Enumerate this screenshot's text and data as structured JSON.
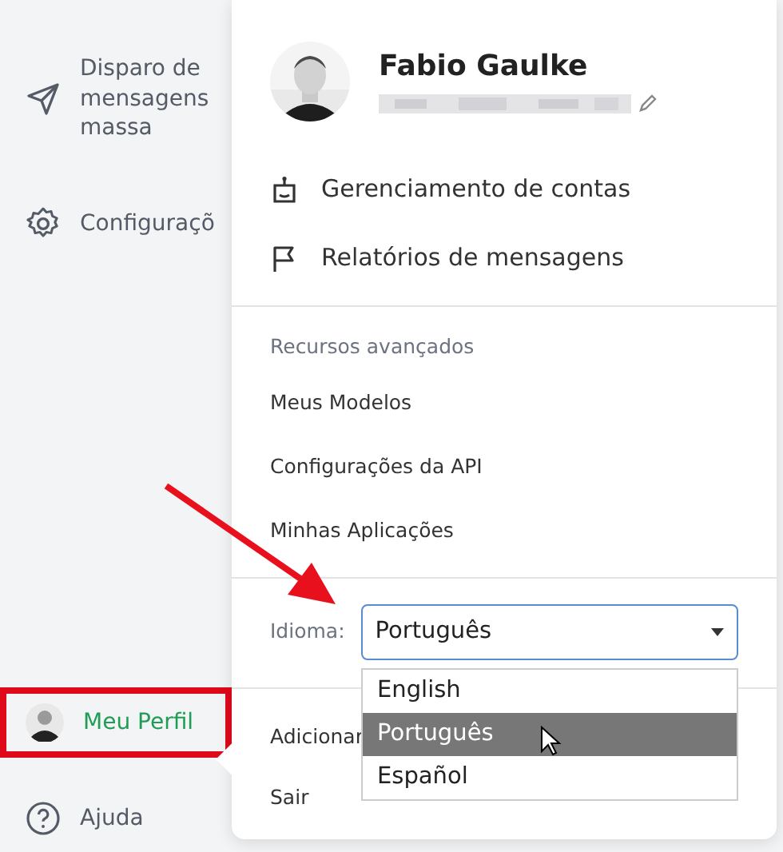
{
  "sidebar": {
    "items": [
      {
        "label": "Disparo de mensagens massa",
        "selected": false,
        "highlighted": false
      },
      {
        "label": "Configuraçõ",
        "selected": false,
        "highlighted": false
      },
      {
        "label": "Meu Perfil",
        "selected": true,
        "highlighted": true
      },
      {
        "label": "Ajuda",
        "selected": false,
        "highlighted": false
      }
    ]
  },
  "profile_menu": {
    "user": {
      "name": "Fabio Gaulke",
      "email_hidden": true
    },
    "main_items": [
      {
        "label": "Gerenciamento de contas"
      },
      {
        "label": "Relatórios de mensagens"
      }
    ],
    "section_title": "Recursos avançados",
    "section_items": [
      "Meus Modelos",
      "Configurações da API",
      "Minhas Aplicações"
    ],
    "language": {
      "label": "Idioma:",
      "value": "Português",
      "expanded": true,
      "options": [
        {
          "label": "English",
          "selected": false
        },
        {
          "label": "Português",
          "selected": true
        },
        {
          "label": "Español",
          "selected": false
        }
      ]
    },
    "footer_items": [
      "Adicionar",
      "Sair"
    ]
  },
  "pointer_arrow": true
}
